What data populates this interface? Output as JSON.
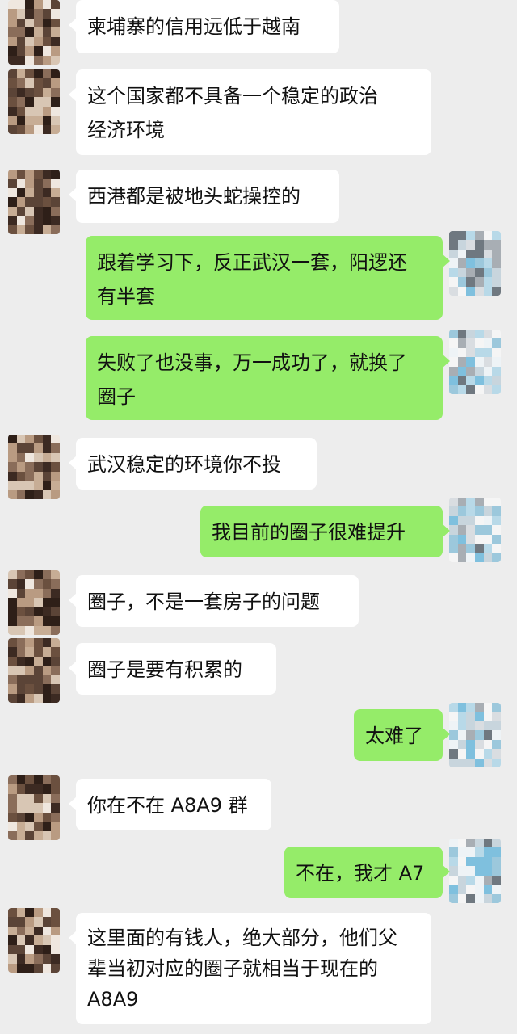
{
  "colors": {
    "background": "#ededed",
    "received_bubble": "#ffffff",
    "sent_bubble": "#95ec69",
    "text": "#111111"
  },
  "messages": [
    {
      "side": "left",
      "text": "柬埔寨的信用远低于越南"
    },
    {
      "side": "left",
      "text": "这个国家都不具备一个稳定的政治\n经济环境"
    },
    {
      "side": "left",
      "text": "西港都是被地头蛇操控的"
    },
    {
      "side": "right",
      "text": "跟着学习下，反正武汉一套，阳逻还\n有半套"
    },
    {
      "side": "right",
      "text": "失败了也没事，万一成功了，就换了\n圈子"
    },
    {
      "side": "left",
      "text": "武汉稳定的环境你不投"
    },
    {
      "side": "right",
      "text": "我目前的圈子很难提升"
    },
    {
      "side": "left",
      "text": "圈子，不是一套房子的问题"
    },
    {
      "side": "left",
      "text": "圈子是要有积累的"
    },
    {
      "side": "right",
      "text": "太难了"
    },
    {
      "side": "left",
      "text": "你在不在 A8A9 群"
    },
    {
      "side": "right",
      "text": "不在，我才 A7"
    },
    {
      "side": "left",
      "text": "这里面的有钱人，绝大部分，他们父\n辈当初对应的圈子就相当于现在的\nA8A9"
    }
  ]
}
